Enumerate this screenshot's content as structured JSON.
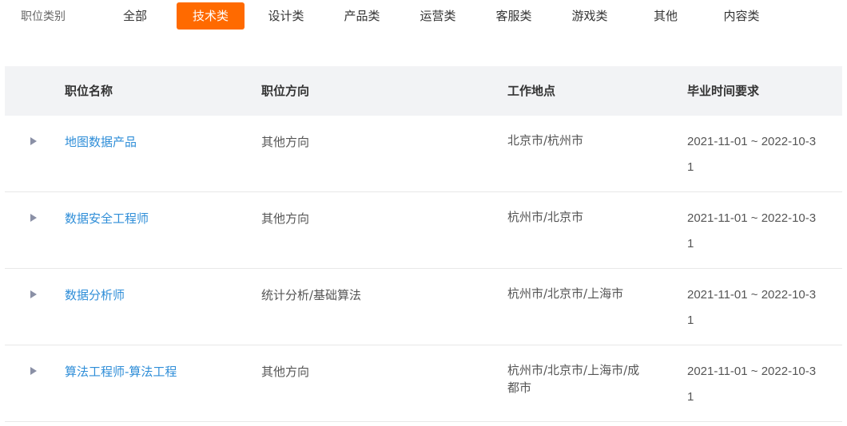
{
  "filter": {
    "label": "职位类别",
    "tabs": [
      {
        "label": "全部",
        "active": false
      },
      {
        "label": "技术类",
        "active": true
      },
      {
        "label": "设计类",
        "active": false
      },
      {
        "label": "产品类",
        "active": false
      },
      {
        "label": "运营类",
        "active": false
      },
      {
        "label": "客服类",
        "active": false
      },
      {
        "label": "游戏类",
        "active": false
      },
      {
        "label": "其他",
        "active": false
      },
      {
        "label": "内容类",
        "active": false
      }
    ]
  },
  "colors": {
    "accent": "#ff6a00",
    "link": "#2f8ed8",
    "header_bg": "#f2f3f5"
  },
  "table": {
    "headers": {
      "name": "职位名称",
      "direction": "职位方向",
      "location": "工作地点",
      "graduation": "毕业时间要求"
    },
    "rows": [
      {
        "name": "地图数据产品",
        "direction": "其他方向",
        "location": "北京市/杭州市",
        "graduation": "2021-11-01 ~ 2022-10-31"
      },
      {
        "name": "数据安全工程师",
        "direction": "其他方向",
        "location": "杭州市/北京市",
        "graduation": "2021-11-01 ~ 2022-10-31"
      },
      {
        "name": "数据分析师",
        "direction": "统计分析/基础算法",
        "location": "杭州市/北京市/上海市",
        "graduation": "2021-11-01 ~ 2022-10-31"
      },
      {
        "name": "算法工程师-算法工程",
        "direction": "其他方向",
        "location": "杭州市/北京市/上海市/成都市",
        "graduation": "2021-11-01 ~ 2022-10-31"
      }
    ]
  }
}
